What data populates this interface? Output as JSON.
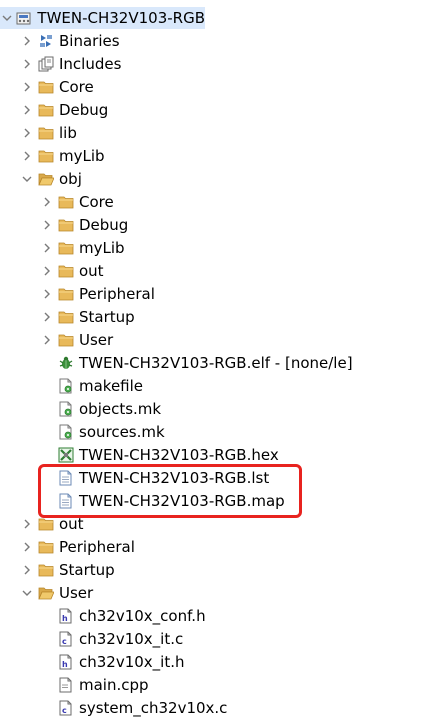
{
  "project": {
    "label": "TWEN-CH32V103-RGB",
    "expanded": true
  },
  "items": [
    {
      "name": "binaries",
      "label": "Binaries",
      "icon": "binaries-icon",
      "expandable": true,
      "expanded": false
    },
    {
      "name": "includes",
      "label": "Includes",
      "icon": "includes-icon",
      "expandable": true,
      "expanded": false
    },
    {
      "name": "core",
      "label": "Core",
      "icon": "folder-icon",
      "expandable": true,
      "expanded": false
    },
    {
      "name": "debug",
      "label": "Debug",
      "icon": "folder-icon",
      "expandable": true,
      "expanded": false
    },
    {
      "name": "lib",
      "label": "lib",
      "icon": "folder-icon",
      "expandable": true,
      "expanded": false
    },
    {
      "name": "mylib",
      "label": "myLib",
      "icon": "folder-icon",
      "expandable": true,
      "expanded": false
    },
    {
      "name": "obj",
      "label": "obj",
      "icon": "folder-icon",
      "expandable": true,
      "expanded": true
    },
    {
      "name": "obj-core",
      "label": "Core",
      "icon": "folder-icon",
      "expandable": true,
      "expanded": false
    },
    {
      "name": "obj-debug",
      "label": "Debug",
      "icon": "folder-icon",
      "expandable": true,
      "expanded": false
    },
    {
      "name": "obj-mylib",
      "label": "myLib",
      "icon": "folder-icon",
      "expandable": true,
      "expanded": false
    },
    {
      "name": "obj-out",
      "label": "out",
      "icon": "folder-icon",
      "expandable": true,
      "expanded": false
    },
    {
      "name": "obj-peripheral",
      "label": "Peripheral",
      "icon": "folder-icon",
      "expandable": true,
      "expanded": false
    },
    {
      "name": "obj-startup",
      "label": "Startup",
      "icon": "folder-icon",
      "expandable": true,
      "expanded": false
    },
    {
      "name": "obj-user",
      "label": "User",
      "icon": "folder-icon",
      "expandable": true,
      "expanded": false
    },
    {
      "name": "elf-file",
      "label": "TWEN-CH32V103-RGB.elf - [none/le]",
      "icon": "elf-bug-icon",
      "expandable": false
    },
    {
      "name": "makefile",
      "label": "makefile",
      "icon": "make-file-icon",
      "expandable": false
    },
    {
      "name": "objects-mk",
      "label": "objects.mk",
      "icon": "make-file-icon",
      "expandable": false
    },
    {
      "name": "sources-mk",
      "label": "sources.mk",
      "icon": "make-file-icon",
      "expandable": false
    },
    {
      "name": "hex-file",
      "label": "TWEN-CH32V103-RGB.hex",
      "icon": "hex-file-icon",
      "expandable": false
    },
    {
      "name": "lst-file",
      "label": "TWEN-CH32V103-RGB.lst",
      "icon": "text-file-icon",
      "expandable": false
    },
    {
      "name": "map-file",
      "label": "TWEN-CH32V103-RGB.map",
      "icon": "text-file-icon",
      "expandable": false
    },
    {
      "name": "out",
      "label": "out",
      "icon": "folder-icon",
      "expandable": true,
      "expanded": false
    },
    {
      "name": "peripheral",
      "label": "Peripheral",
      "icon": "folder-icon",
      "expandable": true,
      "expanded": false
    },
    {
      "name": "startup",
      "label": "Startup",
      "icon": "folder-icon",
      "expandable": true,
      "expanded": false
    },
    {
      "name": "user",
      "label": "User",
      "icon": "folder-icon",
      "expandable": true,
      "expanded": true
    },
    {
      "name": "ch32v10x-conf-h",
      "label": "ch32v10x_conf.h",
      "icon": "h-file-icon",
      "expandable": false
    },
    {
      "name": "ch32v10x-it-c",
      "label": "ch32v10x_it.c",
      "icon": "c-file-icon",
      "expandable": false
    },
    {
      "name": "ch32v10x-it-h",
      "label": "ch32v10x_it.h",
      "icon": "h-file-icon",
      "expandable": false
    },
    {
      "name": "main-cpp",
      "label": "main.cpp",
      "icon": "cpp-file-icon",
      "expandable": false
    },
    {
      "name": "system-ch32v10x-c",
      "label": "system_ch32v10x.c",
      "icon": "c-file-icon",
      "expandable": false
    }
  ],
  "colors": {
    "selection": "#d9e8fb",
    "highlight_box": "#e8231f",
    "folder": "#e8b95a",
    "chevron": "#7a7a7a"
  }
}
